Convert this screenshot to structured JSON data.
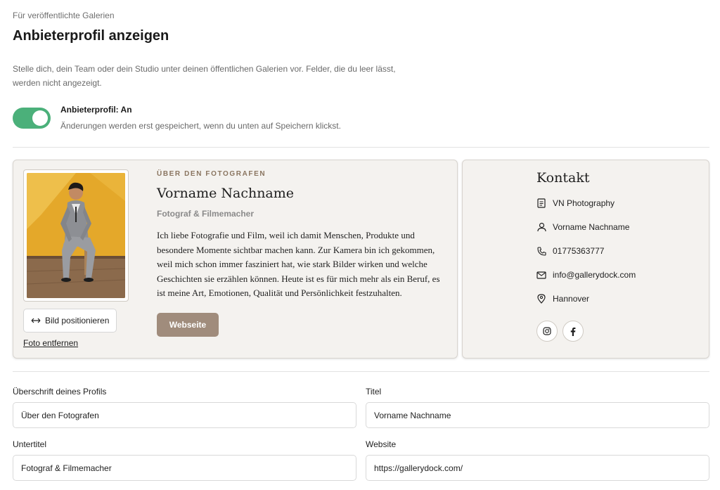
{
  "header": {
    "eyebrow": "Für veröffentlichte Galerien",
    "title": "Anbieterprofil anzeigen",
    "intro": "Stelle dich, dein Team oder dein Studio unter deinen öffentlichen Galerien vor. Felder, die du leer lässt, werden nicht angezeigt."
  },
  "toggle": {
    "label": "Anbieterprofil: An",
    "hint": "Änderungen werden erst gespeichert, wenn du unten auf Speichern klickst.",
    "on": true,
    "color": "#4bb07a"
  },
  "about": {
    "eyebrow": "ÜBER DEN FOTOGRAFEN",
    "name": "Vorname Nachname",
    "subtitle": "Fotograf & Filmemacher",
    "bio": "Ich liebe Fotografie und Film, weil ich damit Menschen, Produkte und besondere Momente sichtbar machen kann. Zur Kamera bin ich gekommen, weil mich schon immer fasziniert hat, wie stark Bilder wirken und welche Geschichten sie erzählen können. Heute ist es für mich mehr als ein Beruf, es ist meine Art, Emotionen, Qualität und Persönlichkeit festzuhalten.",
    "website_button": "Webseite",
    "position_button": "Bild positionieren",
    "position_icon": "arrows-horizontal-icon",
    "remove_link": "Foto entfernen",
    "accent_color": "#a08c7c"
  },
  "contact": {
    "title": "Kontakt",
    "items": [
      {
        "icon": "document-icon",
        "text": "VN Photography"
      },
      {
        "icon": "person-icon",
        "text": "Vorname Nachname"
      },
      {
        "icon": "phone-icon",
        "text": "01775363777"
      },
      {
        "icon": "mail-icon",
        "text": "info@gallerydock.com"
      },
      {
        "icon": "location-pin-icon",
        "text": "Hannover"
      }
    ],
    "social": [
      "instagram-icon",
      "facebook-icon"
    ]
  },
  "form": {
    "heading_label": "Überschrift deines Profils",
    "heading_value": "Über den Fotografen",
    "title_label": "Titel",
    "title_value": "Vorname Nachname",
    "subtitle_label": "Untertitel",
    "subtitle_value": "Fotograf & Filmemacher",
    "website_label": "Website",
    "website_value": "https://gallerydock.com/"
  }
}
